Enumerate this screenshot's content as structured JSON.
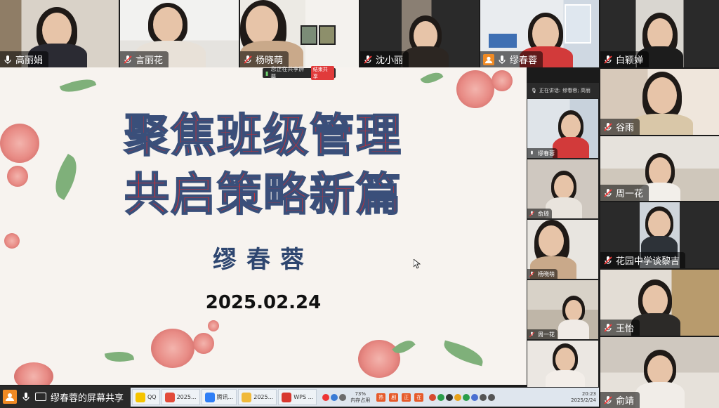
{
  "top_row": [
    {
      "name": "高丽娟",
      "muted": false
    },
    {
      "name": "言丽花",
      "muted": true
    },
    {
      "name": "杨晓萌",
      "muted": true
    },
    {
      "name": "沈小丽",
      "muted": true
    },
    {
      "name": "缪春蓉",
      "muted": false,
      "active": true
    },
    {
      "name": "白颖婵",
      "muted": true
    }
  ],
  "right_column": [
    {
      "name": "谷雨",
      "muted": true
    },
    {
      "name": "周一花",
      "muted": true
    },
    {
      "name": "花园中学谈黎吉",
      "muted": true
    },
    {
      "name": "王怡",
      "muted": true
    },
    {
      "name": "俞靖",
      "muted": true
    }
  ],
  "mini_panel": {
    "speaking_label": "正在讲话:",
    "speaking_name": "缪春蓉; 高丽",
    "tiles": [
      {
        "name": "缪春蓉"
      },
      {
        "name": "俞琦"
      },
      {
        "name": "杨晓萌"
      },
      {
        "name": "周一花"
      },
      {
        "name": ""
      }
    ]
  },
  "share_bar": {
    "text": "您正在共享屏幕",
    "stop_label": "结束共享"
  },
  "slide": {
    "title_line1": "聚焦班级管理",
    "title_line2": "共启策略新篇",
    "speaker": "缪春蓉",
    "date": "2025.02.24"
  },
  "bottom_left": {
    "share_label": "缪春蓉的屏幕共享"
  },
  "taskbar": {
    "apps": [
      {
        "label": "QQ",
        "color": "#f5c400"
      },
      {
        "label": "2025...",
        "color": "#e24b3a"
      },
      {
        "label": "腾讯...",
        "color": "#2f7ef5"
      },
      {
        "label": "2025...",
        "color": "#f0b93a"
      },
      {
        "label": "WPS ...",
        "color": "#d8372f"
      }
    ],
    "memory_percent": "73%",
    "memory_label": "内存占用",
    "hot_labels": [
      "热",
      "剧",
      "正",
      "在"
    ],
    "time": "20:23",
    "date": "2025/2/24"
  },
  "colors": {
    "accent_active": "#38c758",
    "title_red": "#e12a2a",
    "title_stroke": "#3a4f7a",
    "speaker_blue": "#2e4670"
  }
}
